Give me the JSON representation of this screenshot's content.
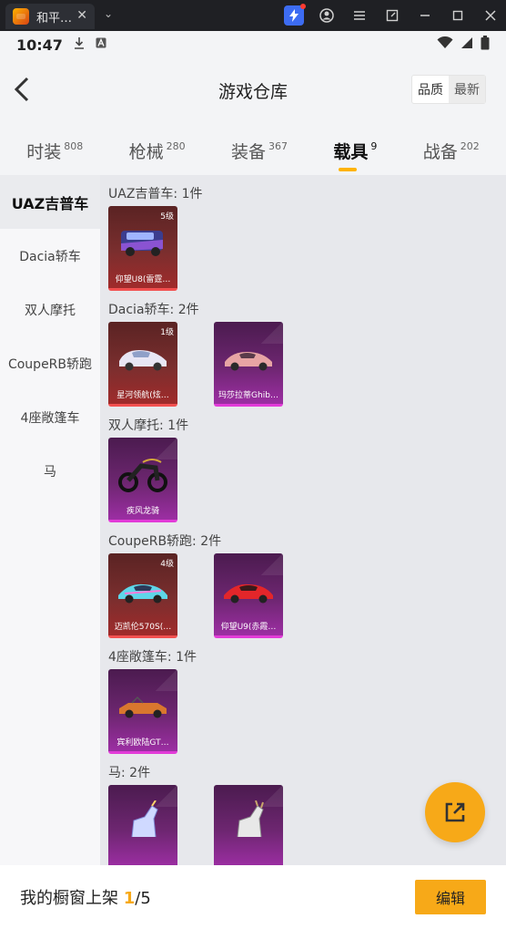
{
  "window": {
    "tab_title": "和平…",
    "tab_close": "✕",
    "dropdown": "⌄"
  },
  "status_bar": {
    "time": "10:47"
  },
  "header": {
    "title": "游戏仓库",
    "sort_quality": "品质",
    "sort_newest": "最新"
  },
  "categories": [
    {
      "label": "时装",
      "count": "808"
    },
    {
      "label": "枪械",
      "count": "280"
    },
    {
      "label": "装备",
      "count": "367"
    },
    {
      "label": "载具",
      "count": "9"
    },
    {
      "label": "战备",
      "count": "202"
    }
  ],
  "sidebar": {
    "items": [
      "UAZ吉普车",
      "Dacia轿车",
      "双人摩托",
      "CoupeRB轿跑",
      "4座敞篷车",
      "马"
    ]
  },
  "groups": [
    {
      "title": "UAZ吉普车: 1件",
      "items": [
        {
          "name": "仰望U8(雷霆…",
          "level": "5级",
          "color": "red"
        }
      ]
    },
    {
      "title": "Dacia轿车: 2件",
      "items": [
        {
          "name": "星河领航(炫…",
          "level": "1级",
          "color": "red"
        },
        {
          "name": "玛莎拉蒂Ghib…",
          "level": "",
          "color": "purple"
        }
      ]
    },
    {
      "title": "双人摩托: 1件",
      "items": [
        {
          "name": "疾风龙骑",
          "level": "",
          "color": "purple"
        }
      ]
    },
    {
      "title": "CoupeRB轿跑: 2件",
      "items": [
        {
          "name": "迈凯伦570S(…",
          "level": "4级",
          "color": "red"
        },
        {
          "name": "仰望U9(赤霞…",
          "level": "",
          "color": "purple"
        }
      ]
    },
    {
      "title": "4座敞篷车: 1件",
      "items": [
        {
          "name": "宾利欧陆GT…",
          "level": "",
          "color": "purple"
        }
      ]
    },
    {
      "title": "马: 2件",
      "items": [
        {
          "name": "",
          "level": "",
          "color": "purple"
        },
        {
          "name": "",
          "level": "",
          "color": "purple"
        }
      ]
    }
  ],
  "footer": {
    "label": "我的橱窗上架 ",
    "current": "1",
    "total": "/5",
    "edit_button": "编辑"
  },
  "colors": {
    "accent": "#f7a918",
    "rarity_red": "#f25050",
    "rarity_purple": "#e23bd8"
  }
}
